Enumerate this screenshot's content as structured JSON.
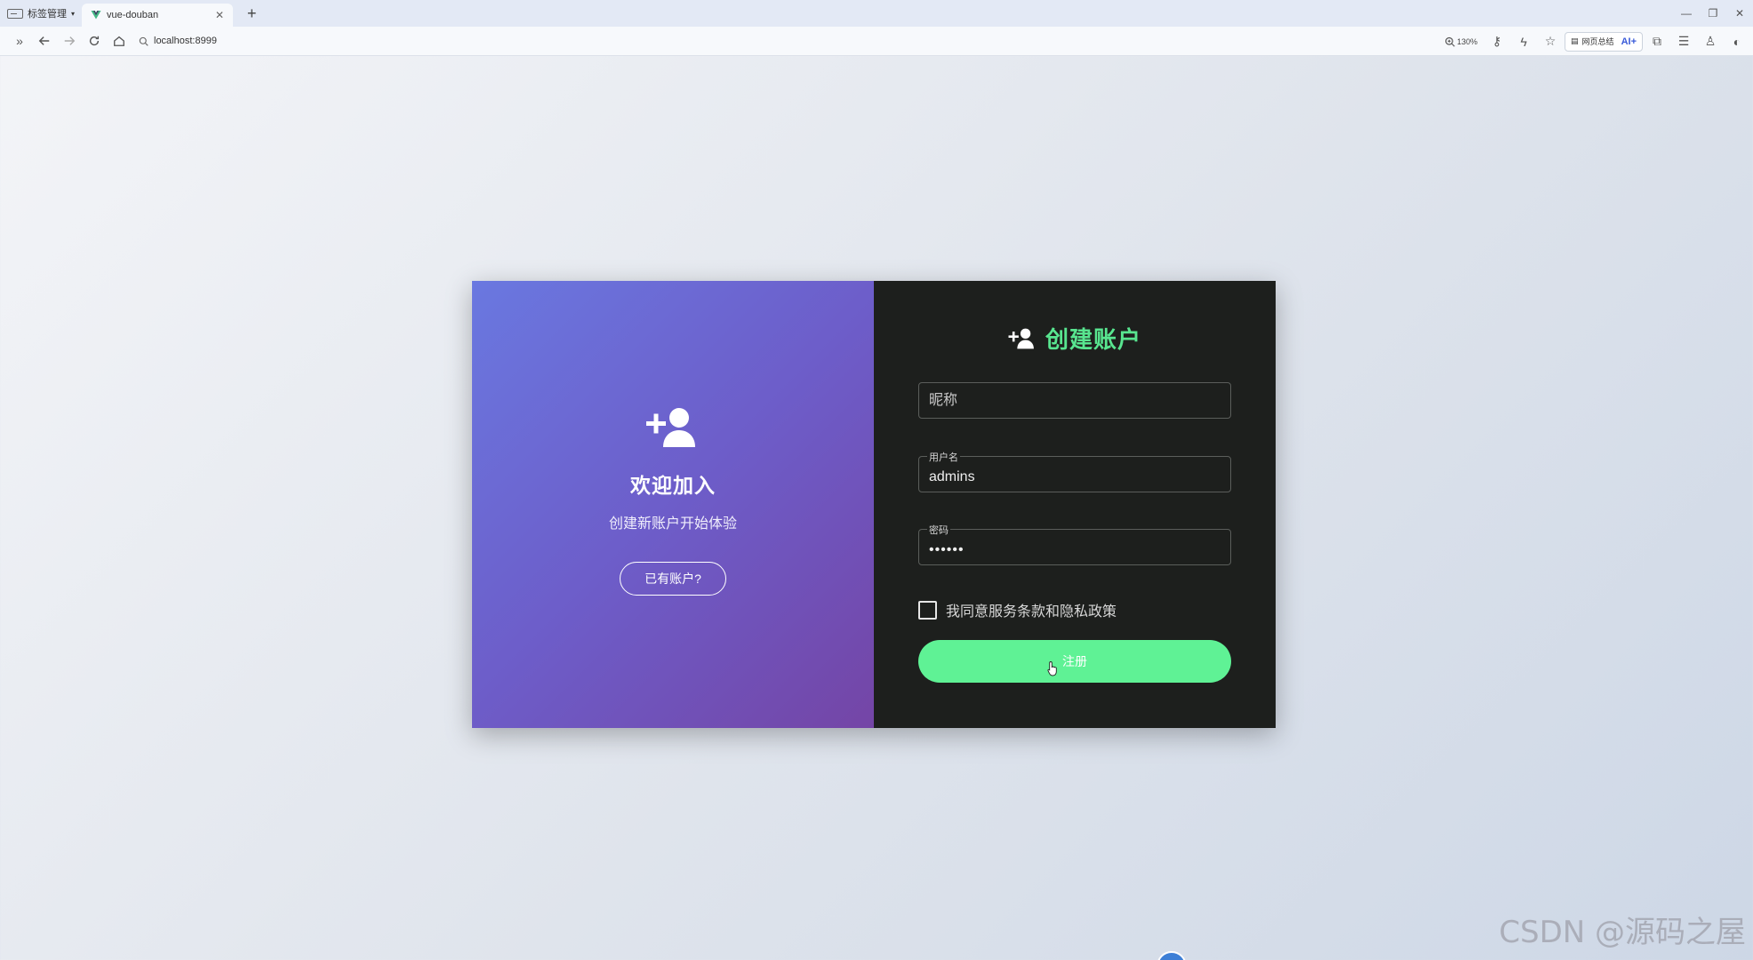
{
  "browser": {
    "tab_manager_label": "标签管理",
    "tab_title": "vue-douban",
    "new_tab": "+",
    "url": "localhost:8999",
    "zoom": "130%",
    "summary_label": "网页总结",
    "ai_label": "AI+"
  },
  "left_panel": {
    "icon": "user-plus-icon",
    "title": "欢迎加入",
    "subtitle": "创建新账户开始体验",
    "button_label": "已有账户?"
  },
  "form": {
    "icon": "user-plus-icon",
    "title": "创建账户",
    "nickname": {
      "placeholder": "昵称",
      "value": ""
    },
    "username": {
      "label": "用户名",
      "value": "admins"
    },
    "password": {
      "label": "密码",
      "value": "••••••"
    },
    "agree_label": "我同意服务条款和隐私政策",
    "agree_checked": false,
    "submit_label": "注册"
  },
  "watermark": "CSDN @源码之屋",
  "colors": {
    "accent_green": "#5ff295",
    "title_green": "#58e58f",
    "panel_dark": "#1d1f1d",
    "gradient_start": "#6a78e0",
    "gradient_end": "#7445a6"
  }
}
